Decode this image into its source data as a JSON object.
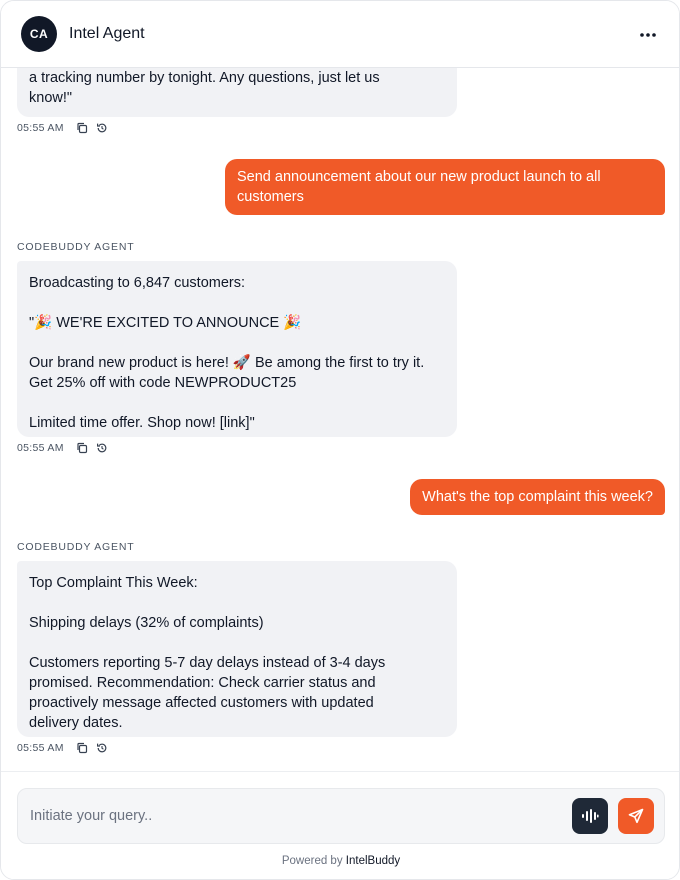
{
  "header": {
    "avatar_initials": "CA",
    "title": "Intel Agent",
    "menu_icon": "more-horizontal-icon"
  },
  "messages": {
    "first": {
      "text": "a tracking number by tonight. Any questions, just let us\nknow!\"",
      "time": "05:55 AM"
    },
    "user_1": {
      "text": "Send announcement about our new product launch to all customers"
    },
    "agent_2": {
      "sender": "CODEBUDDY AGENT",
      "text": "Broadcasting to 6,847 customers:\n\n\"🎉 WE'RE EXCITED TO ANNOUNCE 🎉\n\nOur brand new product is here! 🚀 Be among the first to try it.\nGet 25% off with code NEWPRODUCT25\n\nLimited time offer. Shop now! [link]\"",
      "time": "05:55 AM"
    },
    "user_2": {
      "text": "What's the top complaint this week?"
    },
    "agent_3": {
      "sender": "CODEBUDDY AGENT",
      "text": "Top Complaint This Week:\n\nShipping delays (32% of complaints)\n\nCustomers reporting 5-7 day delays instead of 3-4 days\npromised. Recommendation: Check carrier status and\nproactively message affected customers with updated\ndelivery dates.",
      "time": "05:55 AM"
    }
  },
  "composer": {
    "placeholder": "Initiate your query..",
    "voice_icon": "audio-wave-icon",
    "send_icon": "send-icon"
  },
  "footer": {
    "powered_prefix": "Powered by",
    "brand": "IntelBuddy"
  },
  "colors": {
    "accent": "#f05a28",
    "dark": "#1f2937",
    "agent_bubble": "#f1f2f5"
  }
}
